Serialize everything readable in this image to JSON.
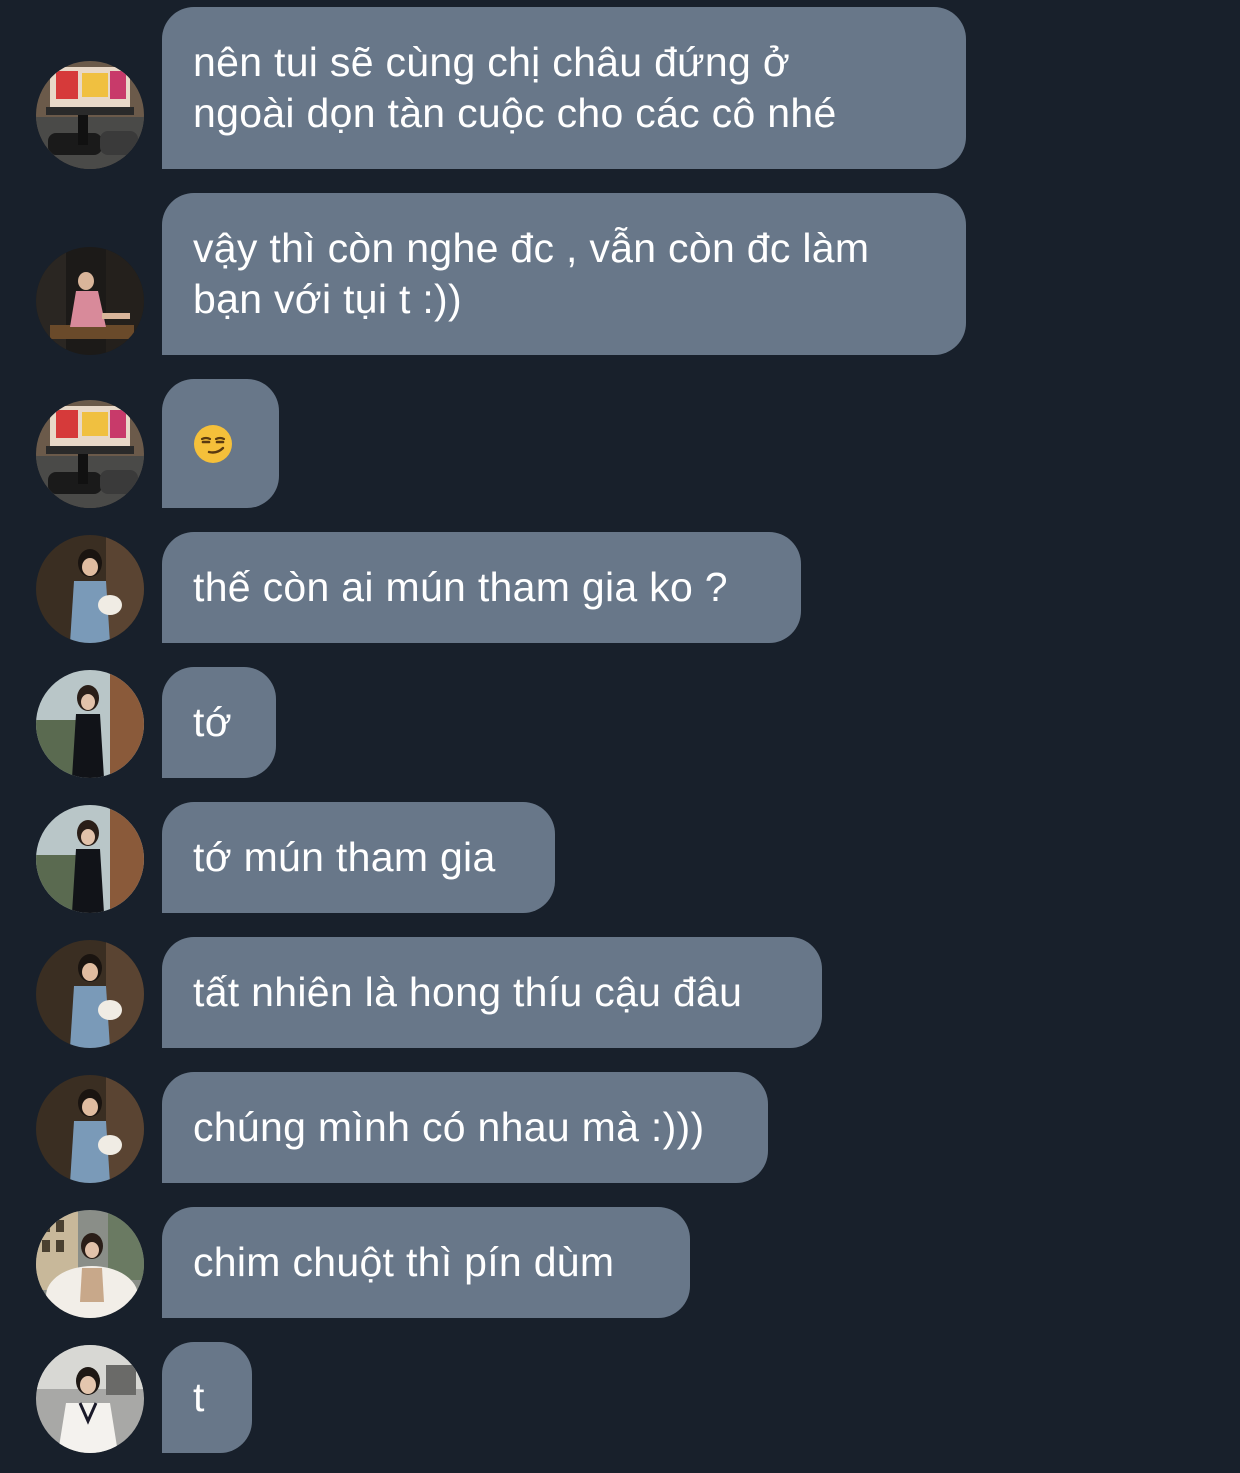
{
  "chat": {
    "messages": [
      {
        "sender_avatar": "avatar-street-storefront",
        "text": "nên tui sẽ cùng chị châu đứng ở\nngoài dọn tàn cuộc cho các cô nhé"
      },
      {
        "sender_avatar": "avatar-dark-pink-dress",
        "text": "vậy thì còn nghe đc , vẫn còn đc làm\nbạn với tụi t :))"
      },
      {
        "sender_avatar": "avatar-street-storefront",
        "text": "",
        "emoji": "smirking-face-icon"
      },
      {
        "sender_avatar": "avatar-denim-handbag",
        "text": "thế còn ai mún tham gia ko ?"
      },
      {
        "sender_avatar": "avatar-black-dress-city",
        "text": "tớ"
      },
      {
        "sender_avatar": "avatar-black-dress-city",
        "text": "tớ mún tham gia"
      },
      {
        "sender_avatar": "avatar-denim-handbag",
        "text": "tất nhiên là hong thíu cậu đâu"
      },
      {
        "sender_avatar": "avatar-denim-handbag",
        "text": "chúng mình có nhau mà :)))"
      },
      {
        "sender_avatar": "avatar-white-fur-building",
        "text": "chim chuột thì pín dùm"
      },
      {
        "sender_avatar": "avatar-white-cardigan",
        "text": "t"
      }
    ]
  }
}
